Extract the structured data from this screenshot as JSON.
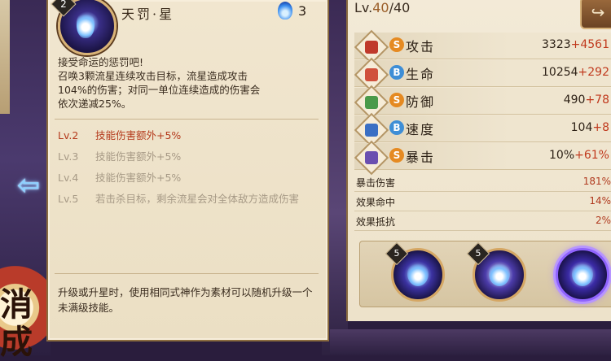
{
  "background": {
    "back_arrow_icon": "left-arrow-icon",
    "seal_text": "消成"
  },
  "skill": {
    "level_badge": "2",
    "name": "天罚·星",
    "icon": "blue-flame-icon",
    "mana_icon": "soul-fire-icon",
    "mana_cost": "3",
    "description": [
      "接受命运的惩罚吧!",
      "召唤3颗流星连续攻击目标，流星造成攻击",
      "104%的伤害；对同一单位连续造成的伤害会",
      "依次递减25%。"
    ],
    "upgrades": [
      {
        "level": "Lv.2",
        "text": "技能伤害额外+5%",
        "state": "active"
      },
      {
        "level": "Lv.3",
        "text": "技能伤害额外+5%",
        "state": "locked"
      },
      {
        "level": "Lv.4",
        "text": "技能伤害额外+5%",
        "state": "locked"
      },
      {
        "level": "Lv.5",
        "text": "若击杀目标，剩余流星会对全体敌方造成伤害",
        "state": "locked"
      }
    ],
    "footer_note": "升级或升星时，使用相同式神作为素材可以随机升级一个未满级技能。"
  },
  "stats": {
    "level_prefix": "Lv.",
    "level_current": "40",
    "level_max": "/40",
    "share_icon": "share-icon",
    "rows": [
      {
        "name": "攻击",
        "grade": "S",
        "base": "3323",
        "bonus": "+4561",
        "icon": "attack-icon",
        "icon_color": "#c0392b"
      },
      {
        "name": "生命",
        "grade": "B",
        "base": "10254",
        "bonus": "+292",
        "icon": "health-icon",
        "icon_color": "#d0503b"
      },
      {
        "name": "防御",
        "grade": "S",
        "base": "490",
        "bonus": "+78",
        "icon": "defense-icon",
        "icon_color": "#4a9a4a"
      },
      {
        "name": "速度",
        "grade": "B",
        "base": "104",
        "bonus": "+8",
        "icon": "speed-icon",
        "icon_color": "#3a6fc4"
      },
      {
        "name": "暴击",
        "grade": "S",
        "base": "10%",
        "bonus": "+61%",
        "icon": "crit-icon",
        "icon_color": "#6a4fb0"
      }
    ],
    "mini_rows": [
      {
        "label": "暴击伤害",
        "value": "181%"
      },
      {
        "label": "效果命中",
        "value": "14%"
      },
      {
        "label": "效果抵抗",
        "value": "2%"
      }
    ]
  },
  "souls": [
    {
      "rank": "5",
      "icon": "blue-flame-soul-icon",
      "selected": false
    },
    {
      "rank": "5",
      "icon": "eyes-soul-icon",
      "selected": false
    },
    {
      "rank": "",
      "icon": "purple-flame-soul-icon",
      "selected": true
    }
  ]
}
